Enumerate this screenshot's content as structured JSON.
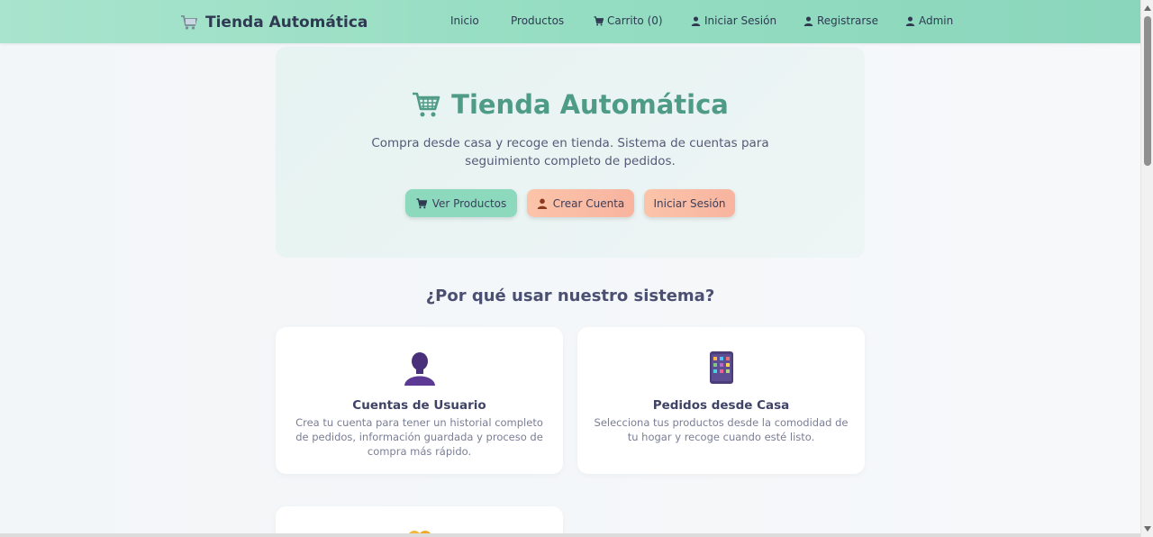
{
  "navbar": {
    "brand": "Tienda Automática",
    "brand_icon": "cart-icon",
    "links": [
      {
        "label": "Inicio",
        "icon": ""
      },
      {
        "label": "Productos",
        "icon": ""
      },
      {
        "label": "Carrito (0)",
        "icon": "cart-icon"
      },
      {
        "label": "Iniciar Sesión",
        "icon": "user-icon"
      },
      {
        "label": "Registrarse",
        "icon": "user-icon"
      },
      {
        "label": "Admin",
        "icon": "user-icon"
      }
    ]
  },
  "hero": {
    "title": "Tienda Automática",
    "subtitle": "Compra desde casa y recoge en tienda. Sistema de cuentas para seguimiento completo de pedidos.",
    "buttons": [
      {
        "label": "Ver Productos",
        "icon": "cart-icon"
      },
      {
        "label": "Crear Cuenta",
        "icon": "user-icon"
      },
      {
        "label": "Iniciar Sesión",
        "icon": ""
      }
    ]
  },
  "features": {
    "title": "¿Por qué usar nuestro sistema?",
    "cards": [
      {
        "icon": "user-silhouette-icon",
        "title": "Cuentas de Usuario",
        "text": "Crea tu cuenta para tener un historial completo de pedidos, información guardada y proceso de compra más rápido."
      },
      {
        "icon": "mobile-phone-icon",
        "title": "Pedidos desde Casa",
        "text": "Selecciona tus productos desde la comodidad de tu hogar y recoge cuando esté listo."
      },
      {
        "icon": "handshake-icon",
        "title": "",
        "text": ""
      }
    ]
  },
  "colors": {
    "accent": "#4e9b86",
    "nav_bg": "#95ddc2",
    "btn_green": "#8cd9bd",
    "btn_peach": "#f8b4a0"
  }
}
